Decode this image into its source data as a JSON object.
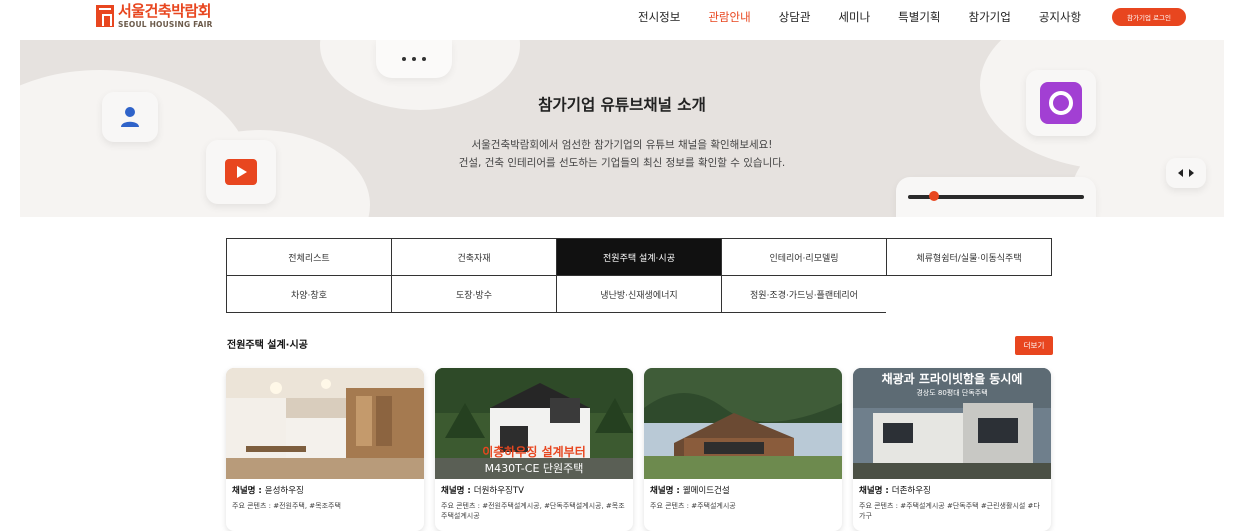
{
  "logo": {
    "korean": "서울건축박람회",
    "english": "SEOUL HOUSING FAIR"
  },
  "nav": {
    "items": [
      {
        "label": "전시정보",
        "active": false
      },
      {
        "label": "관람안내",
        "active": true
      },
      {
        "label": "상담관",
        "active": false
      },
      {
        "label": "세미나",
        "active": false
      },
      {
        "label": "특별기획",
        "active": false
      },
      {
        "label": "참가기업",
        "active": false
      },
      {
        "label": "공지사항",
        "active": false
      }
    ],
    "login_label": "참가기업 로그인"
  },
  "banner": {
    "title": "참가기업 유튜브채널 소개",
    "desc_line1": "서울건축박람회에서 엄선한 참가기업의 유튜브 채널을 확인해보세요!",
    "desc_line2": "건설, 건축 인테리어를 선도하는 기업들의 최신 정보를 확인할 수 있습니다.",
    "slider_progress": 0.15
  },
  "categories": {
    "row1": [
      "전체리스트",
      "건축자재",
      "전원주택 설계·시공",
      "인테리어·리모델링",
      "체류형쉼터/실물·이동식주택"
    ],
    "row2": [
      "차양·창호",
      "도장·방수",
      "냉난방·신재생에너지",
      "정원·조경·가드닝·플랜테리어"
    ],
    "active": "전원주택 설계·시공"
  },
  "section": {
    "title": "전원주택 설계·시공",
    "more_label": "더보기",
    "name_prefix": "채널명 : ",
    "cards": [
      {
        "name": "윤성하우징",
        "content": "주요 콘텐츠 : #전원주택, #목조주택"
      },
      {
        "name": "더원하우징TV",
        "content": "주요 콘텐츠 : #전원주택설계시공, #단독주택설계시공, #목조주택설계시공"
      },
      {
        "name": "웰메이드건설",
        "content": "주요 콘텐츠 : #주택설계시공"
      },
      {
        "name": "더존하우징",
        "content": "주요 콘텐츠 : #주택설계시공 #단독주택 #근린생활시설 #다가구"
      }
    ]
  },
  "thumb_text": {
    "card2_line1": "이층하우징 설계부터",
    "card2_line2": "M430T-CE 단원주택",
    "card4_line1": "채광과 프라이빗함을 동시에",
    "card4_line2": "경상도 80평대 단독주택"
  },
  "colors": {
    "accent": "#e8461f",
    "banner_bg": "#e6e2df",
    "active_cat": "#111111"
  }
}
